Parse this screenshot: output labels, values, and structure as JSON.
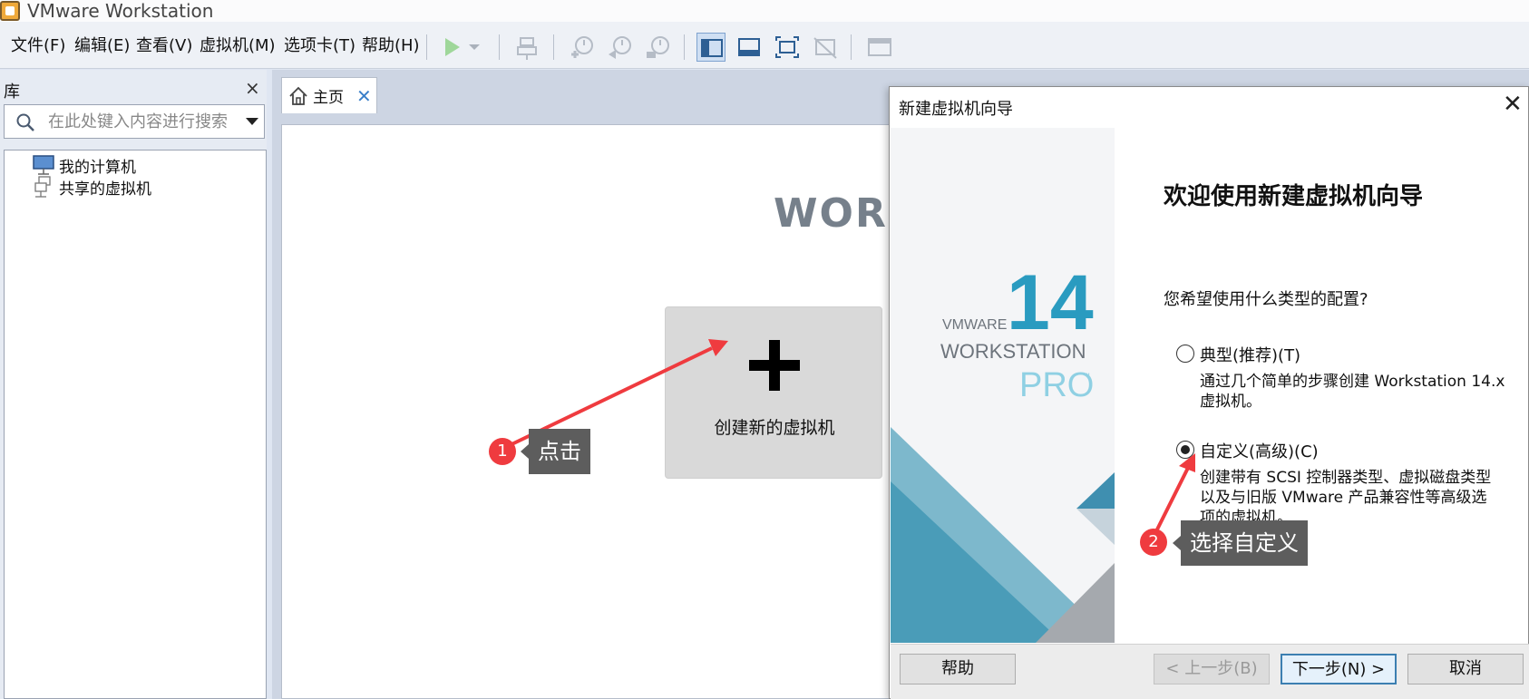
{
  "app": {
    "title": "VMware Workstation"
  },
  "menu": [
    "文件(F)",
    "编辑(E)",
    "查看(V)",
    "虚拟机(M)",
    "选项卡(T)",
    "帮助(H)"
  ],
  "toolbar_icons": [
    "play-icon",
    "play-dropdown-icon",
    "send-ctrl-alt-del-icon",
    "snapshot-take-icon",
    "snapshot-revert-icon",
    "snapshot-manager-icon",
    "show-library-icon",
    "show-thumbnail-bar-icon",
    "full-screen-icon",
    "unity-icon",
    "console-view-icon"
  ],
  "library": {
    "title": "库",
    "close": "×",
    "search_placeholder": "在此处键入内容进行搜索",
    "items": [
      "我的计算机",
      "共享的虚拟机"
    ]
  },
  "tab": {
    "label": "主页",
    "close": "✕"
  },
  "home": {
    "heading": "WORK",
    "create_label": "创建新的虚拟机"
  },
  "callouts": [
    {
      "badge": "1",
      "text": "点击"
    },
    {
      "badge": "2",
      "text": "选择自定义"
    }
  ],
  "wizard": {
    "title": "新建虚拟机向导",
    "close": "✕",
    "brand": {
      "vmware": "VMWARE",
      "version": "14",
      "product": "WORKSTATION",
      "edition": "PRO",
      "tm": "™"
    },
    "heading": "欢迎使用新建虚拟机向导",
    "question": "您希望使用什么类型的配置?",
    "options": [
      {
        "label": "典型(推荐)(T)",
        "desc1": "通过几个简单的步骤创建 Workstation 14.x",
        "desc2": "虚拟机。",
        "checked": false
      },
      {
        "label": "自定义(高级)(C)",
        "desc1": "创建带有 SCSI 控制器类型、虚拟磁盘类型",
        "desc2": "以及与旧版 VMware 产品兼容性等高级选",
        "desc3": "项的虚拟机。",
        "checked": true
      }
    ],
    "buttons": {
      "help": "帮助",
      "back": "< 上一步(B)",
      "next": "下一步(N) >",
      "cancel": "取消"
    }
  },
  "colors": {
    "accent_blue": "#3a7fc9",
    "callout_red": "#ef3b3f",
    "callout_gray": "#5d5d5d",
    "brand_teal": "#2a9bc0"
  }
}
